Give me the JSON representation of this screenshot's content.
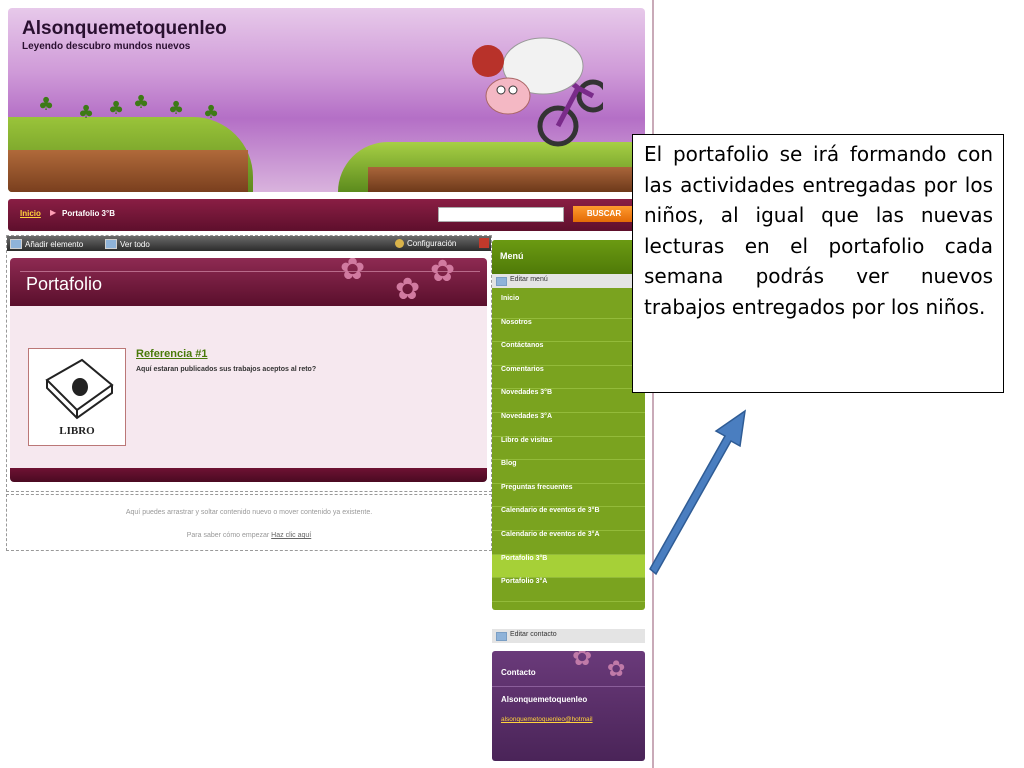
{
  "header": {
    "title": "Alsonquemetoquenleo",
    "subtitle": "Leyendo descubro mundos nuevos"
  },
  "breadcrumb": {
    "home": "Inicio",
    "current": "Portafolio 3°B"
  },
  "search": {
    "value": "",
    "button": "BUSCAR"
  },
  "toolbar": {
    "add": "Añadir elemento",
    "view_all": "Ver todo",
    "config": "Configuración"
  },
  "panel": {
    "title": "Portafolio",
    "thumb_label": "LIBRO",
    "ref_title": "Referencia #1",
    "ref_desc": "Aquí estaran publicados sus trabajos aceptos al reto?"
  },
  "help": {
    "line1": "Aquí puedes arrastrar y soltar contenido nuevo o mover contenido ya existente.",
    "line2": "Para saber cómo empezar",
    "link": "Haz clic aquí"
  },
  "menu": {
    "title": "Menú",
    "edit_label": "Editar menú",
    "items": [
      {
        "label": "Inicio"
      },
      {
        "label": "Nosotros"
      },
      {
        "label": "Contáctanos"
      },
      {
        "label": "Comentarios"
      },
      {
        "label": "Novedades 3°B"
      },
      {
        "label": "Novedades 3°A"
      },
      {
        "label": "Libro de visitas"
      },
      {
        "label": "Blog"
      },
      {
        "label": "Preguntas frecuentes"
      },
      {
        "label": "Calendario de eventos de 3°B"
      },
      {
        "label": "Calendario de eventos de 3°A"
      },
      {
        "label": "Portafolio 3°B"
      },
      {
        "label": "Portafolio 3°A"
      }
    ],
    "active_index": 11
  },
  "contact": {
    "edit_label": "Editar contacto",
    "title": "Contacto",
    "name": "Alsonquemetoquenleo",
    "email": "alsonquemetoquenleo@hotmail"
  },
  "callout": {
    "text": "El portafolio se irá formando con las actividades entregadas por los niños, al igual que las nuevas lecturas en el portafolio cada semana podrás ver nuevos trabajos entregados por los niños."
  },
  "colors": {
    "nav": "#6e1535",
    "menu_green": "#7aa31f",
    "menu_active": "#a6d037",
    "contact_purple": "#5a2e6a",
    "arrow_blue": "#4a7ec0",
    "search_button": "#f0820f"
  }
}
